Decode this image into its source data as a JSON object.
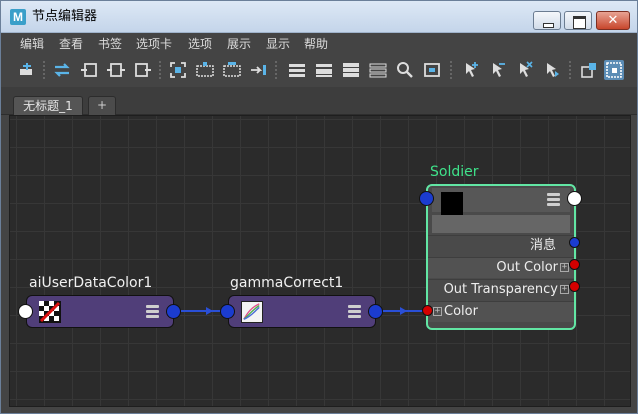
{
  "window": {
    "title": "节点编辑器",
    "app_icon_letter": "M",
    "close_glyph": "✕"
  },
  "menubar": {
    "items": [
      "编辑",
      "查看",
      "书签",
      "选项卡",
      "选项",
      "展示",
      "显示",
      "帮助"
    ]
  },
  "toolbar": {
    "icons": [
      "add-node-icon",
      "swap-icon",
      "input-connections-icon",
      "input-output-connections-icon",
      "output-connections-icon",
      "frame-all-icon",
      "graph-add-icon",
      "graph-remove-icon",
      "graph-expand-icon",
      "simple-layout-icon",
      "connected-layout-icon",
      "full-layout-icon",
      "custom-layout-icon",
      "search-icon",
      "snapshot-icon",
      "pin-add-icon",
      "pin-remove-icon",
      "pin-clear-icon",
      "pin-select-icon",
      "toggle-swatch-icon",
      "grid-toggle-icon"
    ]
  },
  "tabs": {
    "active_label": "无标题_1",
    "add_label": "+"
  },
  "graph": {
    "nodes": {
      "ai_user_data": {
        "title": "aiUserDataColor1"
      },
      "gamma": {
        "title": "gammaCorrect1"
      },
      "soldier": {
        "title": "Soldier",
        "attributes": [
          {
            "label": "消息"
          },
          {
            "label": "Out Color"
          },
          {
            "label": "Out Transparency"
          },
          {
            "label": "Color"
          }
        ]
      }
    },
    "colors": {
      "node_fill": "#503e79",
      "port_blue": "#1b3ccf",
      "port_red": "#d40000",
      "selected_outline": "#62e6a4",
      "connection": "#2a4fd6"
    }
  }
}
